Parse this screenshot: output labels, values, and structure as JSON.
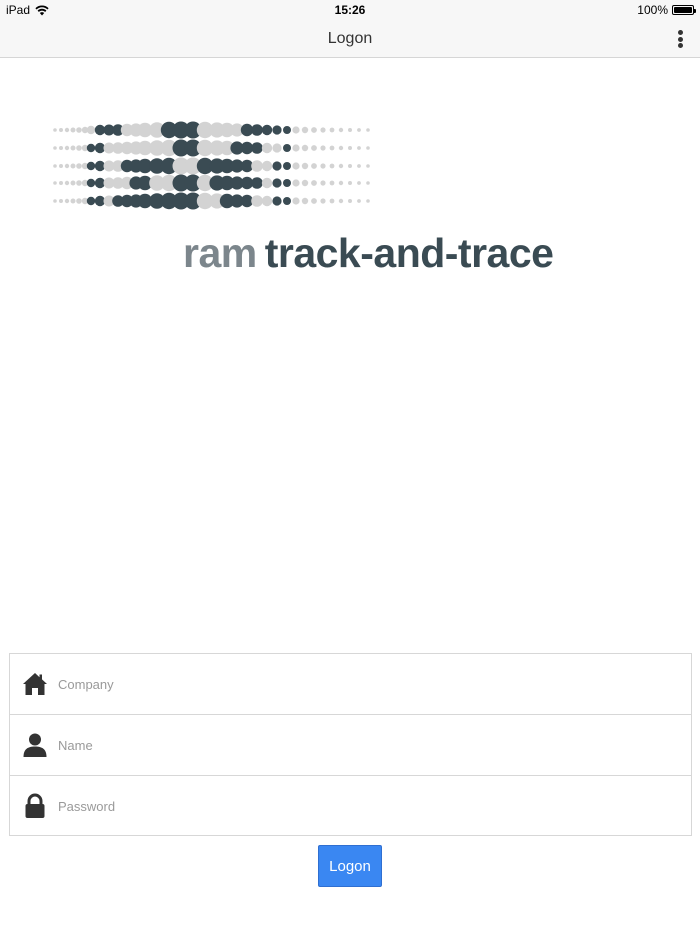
{
  "status_bar": {
    "device": "iPad",
    "time": "15:26",
    "battery": "100%"
  },
  "nav": {
    "title": "Logon",
    "menu_icon": "more-vertical-icon"
  },
  "logo": {
    "word1": "ram",
    "word2": "track-and-trace",
    "dot_dark": "#3a4b53",
    "dot_light": "#d3d3d3"
  },
  "form": {
    "company": {
      "placeholder": "Company",
      "value": "",
      "icon": "home-icon"
    },
    "name": {
      "placeholder": "Name",
      "value": "",
      "icon": "user-icon"
    },
    "password": {
      "placeholder": "Password",
      "value": "",
      "icon": "lock-icon"
    }
  },
  "logon_button": {
    "label": "Logon",
    "color": "#3a87f2"
  }
}
